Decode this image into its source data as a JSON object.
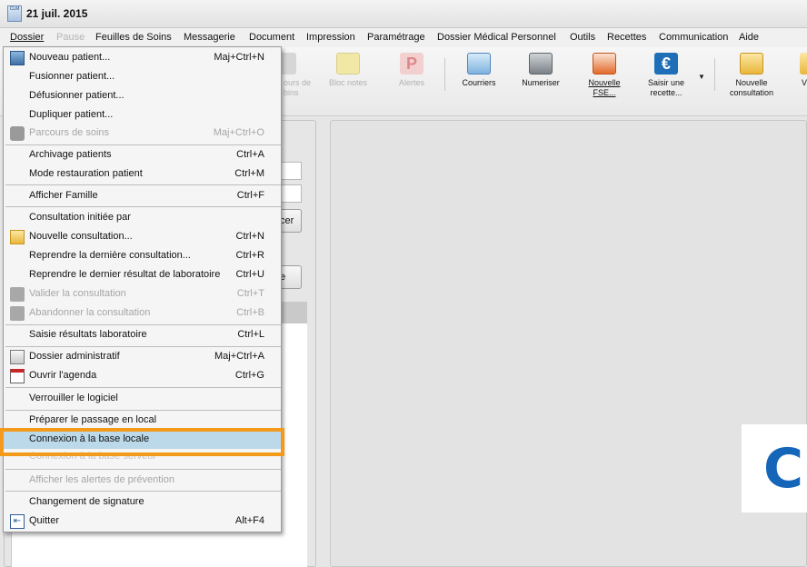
{
  "window": {
    "title": "21 juil. 2015",
    "app_icon_text": "CLM"
  },
  "menubar": [
    {
      "label": "Dossier",
      "state": "active"
    },
    {
      "label": "Pause",
      "state": "disabled"
    },
    {
      "label": "Feuilles de Soins",
      "state": "normal"
    },
    {
      "label": "Messagerie",
      "state": "normal"
    },
    {
      "label": "Document",
      "state": "normal"
    },
    {
      "label": "Impression",
      "state": "normal"
    },
    {
      "label": "Paramétrage",
      "state": "normal"
    },
    {
      "label": "Dossier Médical Personnel",
      "state": "normal"
    },
    {
      "label": "Outils",
      "state": "normal"
    },
    {
      "label": "Recettes",
      "state": "normal"
    },
    {
      "label": "Communication",
      "state": "normal"
    },
    {
      "label": "Aide",
      "state": "normal"
    }
  ],
  "toolbar": [
    {
      "label": "ours de\nbins",
      "icon": "parcours-icon",
      "disabled": true
    },
    {
      "label": "Bloc notes",
      "icon": "notes-icon",
      "disabled": true
    },
    {
      "label": "Alertes",
      "icon": "alert-p-icon",
      "disabled": true
    },
    {
      "label": "Courriers",
      "icon": "mail-icon",
      "disabled": false
    },
    {
      "label": "Numeriser",
      "icon": "scanner-icon",
      "disabled": false
    },
    {
      "label": "Nouvelle\nFSE...",
      "icon": "fse-icon",
      "disabled": false
    },
    {
      "label": "Saisir une\nrecette...",
      "icon": "euro-icon",
      "disabled": false
    },
    {
      "label": "Nouvelle\nconsultation",
      "icon": "new-folder-icon",
      "disabled": false
    },
    {
      "label": "V",
      "icon": "folder-icon",
      "disabled": false
    }
  ],
  "background": {
    "partial_button_1": "cer",
    "partial_button_2": "e",
    "logo_letter": "C"
  },
  "dropdown": [
    {
      "label": "Nouveau patient...",
      "shortcut": "Maj+Ctrl+N",
      "icon": "user-icon",
      "state": "normal"
    },
    {
      "label": "Fusionner patient...",
      "shortcut": "",
      "icon": "",
      "state": "normal"
    },
    {
      "label": "Défusionner patient...",
      "shortcut": "",
      "icon": "",
      "state": "normal"
    },
    {
      "label": "Dupliquer patient...",
      "shortcut": "",
      "icon": "",
      "state": "normal"
    },
    {
      "label": "Parcours de soins",
      "shortcut": "Maj+Ctrl+O",
      "icon": "parcours-icon",
      "state": "disabled"
    },
    {
      "label": "Archivage patients",
      "shortcut": "Ctrl+A",
      "icon": "",
      "state": "normal"
    },
    {
      "label": "Mode restauration patient",
      "shortcut": "Ctrl+M",
      "icon": "",
      "state": "normal"
    },
    {
      "label": "Afficher Famille",
      "shortcut": "Ctrl+F",
      "icon": "",
      "state": "normal"
    },
    {
      "label": "Consultation initiée par",
      "shortcut": "",
      "icon": "",
      "state": "normal"
    },
    {
      "label": "Nouvelle consultation...",
      "shortcut": "Ctrl+N",
      "icon": "new-consultation-icon",
      "state": "normal"
    },
    {
      "label": "Reprendre la dernière consultation...",
      "shortcut": "Ctrl+R",
      "icon": "",
      "state": "normal"
    },
    {
      "label": "Reprendre le dernier résultat de laboratoire",
      "shortcut": "Ctrl+U",
      "icon": "",
      "state": "normal"
    },
    {
      "label": "Valider la consultation",
      "shortcut": "Ctrl+T",
      "icon": "validate-icon",
      "state": "disabled"
    },
    {
      "label": "Abandonner la consultation",
      "shortcut": "Ctrl+B",
      "icon": "abandon-icon",
      "state": "disabled"
    },
    {
      "label": "Saisie résultats laboratoire",
      "shortcut": "Ctrl+L",
      "icon": "",
      "state": "normal"
    },
    {
      "label": "Dossier administratif",
      "shortcut": "Maj+Ctrl+A",
      "icon": "admin-file-icon",
      "state": "normal"
    },
    {
      "label": "Ouvrir l'agenda",
      "shortcut": "Ctrl+G",
      "icon": "calendar-icon",
      "state": "normal"
    },
    {
      "label": "Verrouiller le logiciel",
      "shortcut": "",
      "icon": "",
      "state": "normal"
    },
    {
      "label": "Préparer le passage en local",
      "shortcut": "",
      "icon": "",
      "state": "normal"
    },
    {
      "label": "Connexion à la base locale",
      "shortcut": "",
      "icon": "",
      "state": "highlight"
    },
    {
      "label": "Connexion à la base serveur",
      "shortcut": "",
      "icon": "",
      "state": "faded"
    },
    {
      "label": "Afficher les alertes de prévention",
      "shortcut": "",
      "icon": "",
      "state": "disabled"
    },
    {
      "label": "Changement de signature",
      "shortcut": "",
      "icon": "",
      "state": "normal"
    },
    {
      "label": "Quitter",
      "shortcut": "Alt+F4",
      "icon": "exit-icon",
      "state": "normal"
    }
  ],
  "colors": {
    "highlight": "#bcd9ea",
    "callout": "#f39a1a",
    "logo": "#1565b8"
  }
}
